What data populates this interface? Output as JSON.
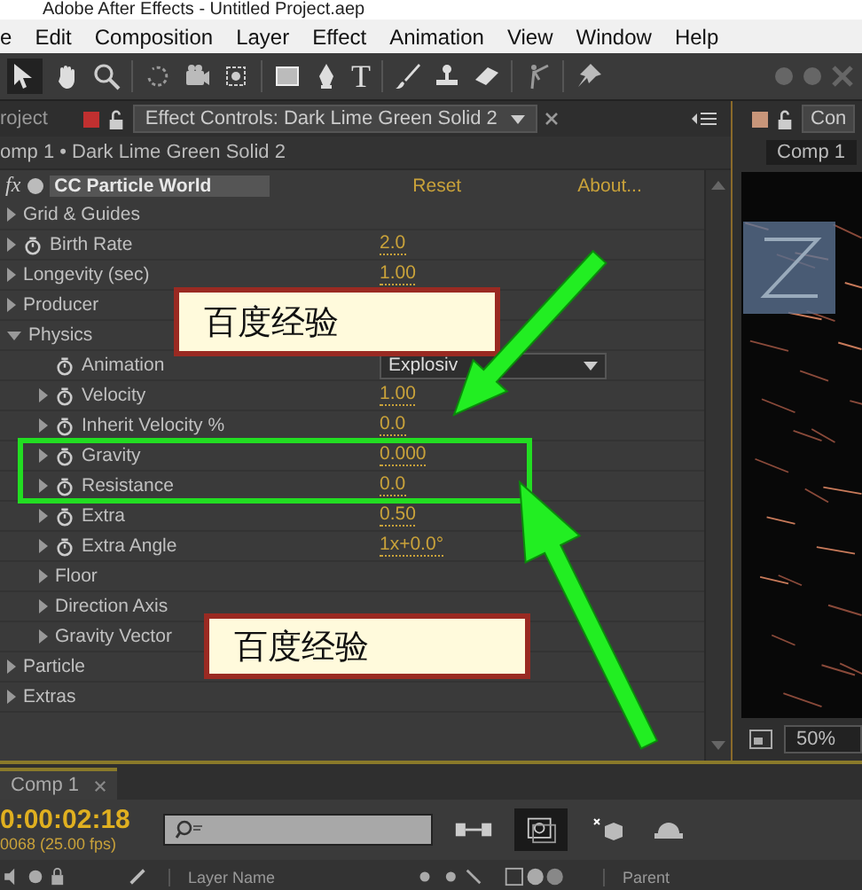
{
  "window": {
    "title": "Adobe After Effects - Untitled Project.aep"
  },
  "menu": [
    "e",
    "Edit",
    "Composition",
    "Layer",
    "Effect",
    "Animation",
    "View",
    "Window",
    "Help"
  ],
  "toolbar": {
    "type_tool": "T"
  },
  "panel_tabs": {
    "project": "roject",
    "effect_controls": "Effect Controls: Dark Lime Green Solid 2",
    "right": "Con"
  },
  "breadcrumb": "omp 1 • Dark Lime Green Solid 2",
  "viewer_tab": "Comp 1",
  "effect": {
    "badge": "fx",
    "name": "CC Particle World",
    "reset": "Reset",
    "about": "About...",
    "params": [
      {
        "kind": "group",
        "label": "Grid & Guides",
        "expanded": false
      },
      {
        "kind": "param",
        "label": "Birth Rate",
        "value": "2.0",
        "expanded": false
      },
      {
        "kind": "group",
        "label": "Longevity (sec)",
        "value": "1.00",
        "expanded": false
      },
      {
        "kind": "group",
        "label": "Producer",
        "expanded": false
      },
      {
        "kind": "group",
        "label": "Physics",
        "expanded": true,
        "children": [
          {
            "kind": "choice",
            "label": "Animation",
            "value": "Explosiv"
          },
          {
            "kind": "param",
            "label": "Velocity",
            "value": "1.00",
            "expanded": false
          },
          {
            "kind": "param",
            "label": "Inherit Velocity %",
            "value": "0.0",
            "expanded": false
          },
          {
            "kind": "param",
            "label": "Gravity",
            "value": "0.000",
            "expanded": false
          },
          {
            "kind": "param",
            "label": "Resistance",
            "value": "0.0",
            "expanded": false
          },
          {
            "kind": "param",
            "label": "Extra",
            "value": "0.50",
            "expanded": false
          },
          {
            "kind": "param",
            "label": "Extra Angle",
            "value": "1x+0.0°",
            "expanded": false
          },
          {
            "kind": "group",
            "label": "Floor",
            "expanded": false
          },
          {
            "kind": "group",
            "label": "Direction Axis",
            "expanded": false
          },
          {
            "kind": "group",
            "label": "Gravity Vector",
            "expanded": false
          }
        ]
      },
      {
        "kind": "group",
        "label": "Particle",
        "expanded": false
      },
      {
        "kind": "group",
        "label": "Extras",
        "expanded": false
      }
    ]
  },
  "viewer": {
    "zoom": "50%"
  },
  "timeline": {
    "tab": "Comp 1",
    "timecode": "0:00:02:18",
    "frame_info": "0068 (25.00 fps)",
    "columns": [
      "Layer Name",
      "Parent"
    ]
  },
  "annotations": {
    "callouts": [
      "百度经验",
      "百度经验"
    ]
  }
}
